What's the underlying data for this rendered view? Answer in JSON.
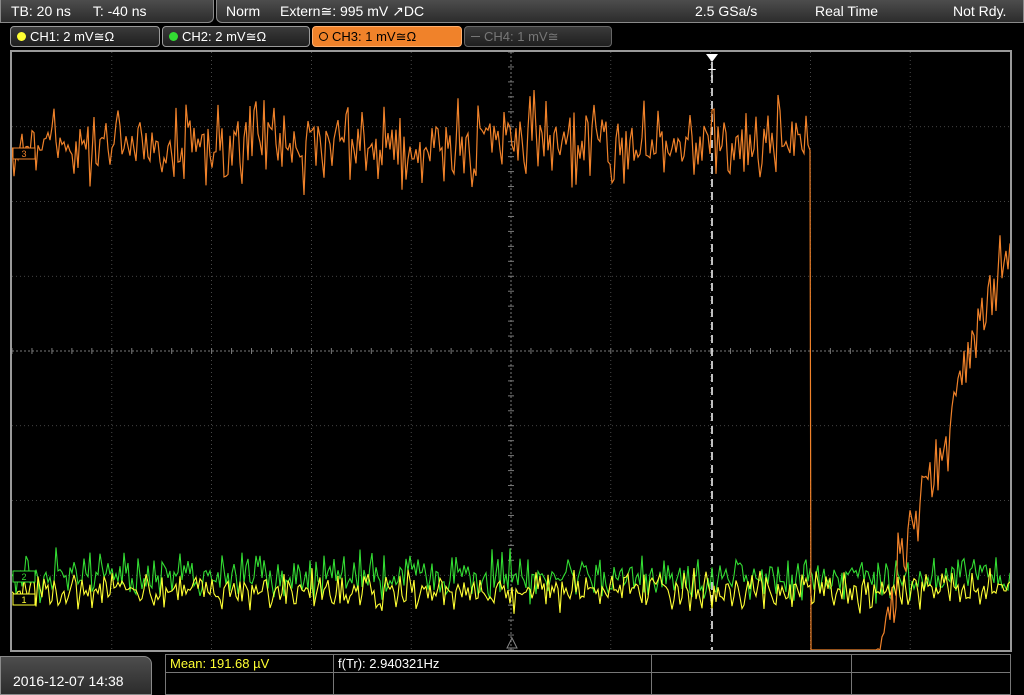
{
  "topbar": {
    "timebase": "TB: 20 ns",
    "trigger_time": "T: -40 ns",
    "trigger_mode": "Norm",
    "trigger_source": "Extern≅: 995 mV ↗DC",
    "sample_rate": "2.5 GSa/s",
    "acq_mode": "Real Time",
    "status": "Not Rdy."
  },
  "channels": [
    {
      "label": "CH1: 2 mV≅Ω",
      "color": "#ffff33",
      "state": "on"
    },
    {
      "label": "CH2: 2 mV≅Ω",
      "color": "#33dd33",
      "state": "on"
    },
    {
      "label": "CH3: 1 mV≅Ω",
      "color": "#f0822a",
      "state": "active"
    },
    {
      "label": "CH4: 1 mV≅",
      "color": "#777777",
      "state": "off"
    }
  ],
  "markers": {
    "trigger": "T",
    "ch3_ref": "3",
    "ch2_ref": "2",
    "ch1_ref": "1"
  },
  "colors": {
    "ch1": "#ffff33",
    "ch2": "#33dd33",
    "ch3": "#f0822a",
    "grid": "#5a5a5a"
  },
  "measurements": {
    "mean": "Mean: 191.68 µV",
    "frequency": "f(Tr): 2.940321Hz"
  },
  "datetime": "2016-12-07 14:38"
}
